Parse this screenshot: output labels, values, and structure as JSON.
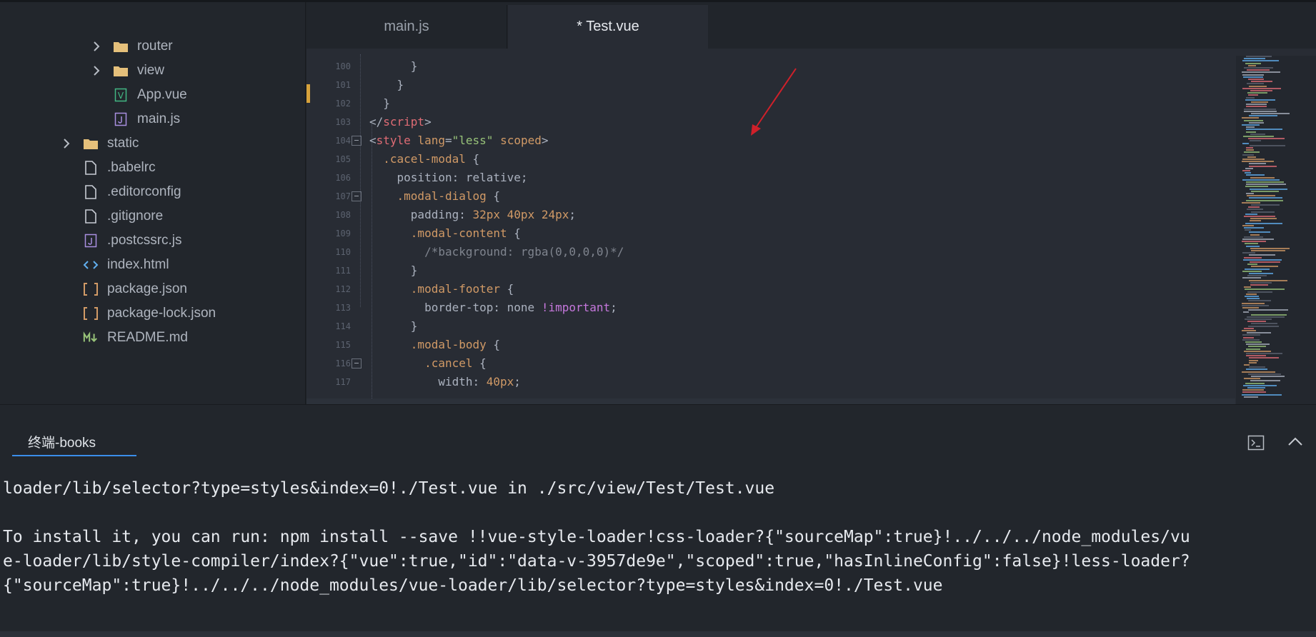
{
  "sidebar": {
    "items": [
      {
        "label": "router",
        "kind": "folder",
        "expandable": true,
        "depth": 2
      },
      {
        "label": "view",
        "kind": "folder",
        "expandable": true,
        "depth": 2
      },
      {
        "label": "App.vue",
        "kind": "vue",
        "expandable": false,
        "depth": 2
      },
      {
        "label": "main.js",
        "kind": "js",
        "expandable": false,
        "depth": 2
      },
      {
        "label": "static",
        "kind": "folder",
        "expandable": true,
        "depth": 1
      },
      {
        "label": ".babelrc",
        "kind": "file",
        "expandable": false,
        "depth": 1
      },
      {
        "label": ".editorconfig",
        "kind": "file",
        "expandable": false,
        "depth": 1
      },
      {
        "label": ".gitignore",
        "kind": "file",
        "expandable": false,
        "depth": 1
      },
      {
        "label": ".postcssrc.js",
        "kind": "js",
        "expandable": false,
        "depth": 1
      },
      {
        "label": "index.html",
        "kind": "html",
        "expandable": false,
        "depth": 1
      },
      {
        "label": "package.json",
        "kind": "json",
        "expandable": false,
        "depth": 1
      },
      {
        "label": "package-lock.json",
        "kind": "json",
        "expandable": false,
        "depth": 1
      },
      {
        "label": "README.md",
        "kind": "md",
        "expandable": false,
        "depth": 1
      }
    ]
  },
  "tabs": [
    {
      "label": "main.js",
      "active": false
    },
    {
      "label": "* Test.vue",
      "active": true
    }
  ],
  "code": {
    "lines": [
      {
        "n": "100",
        "fold": false,
        "segs": [
          [
            "t-brace",
            "      }"
          ]
        ]
      },
      {
        "n": "101",
        "fold": false,
        "segs": [
          [
            "t-brace",
            "    }"
          ]
        ]
      },
      {
        "n": "102",
        "fold": false,
        "segs": [
          [
            "t-brace",
            "  }"
          ]
        ]
      },
      {
        "n": "103",
        "fold": false,
        "segs": [
          [
            "t-plain",
            "</"
          ],
          [
            "t-tag",
            "script"
          ],
          [
            "t-plain",
            ">"
          ]
        ]
      },
      {
        "n": "104",
        "fold": true,
        "segs": [
          [
            "t-plain",
            "<"
          ],
          [
            "t-tag",
            "style"
          ],
          [
            "t-plain",
            " "
          ],
          [
            "t-attr",
            "lang"
          ],
          [
            "t-plain",
            "="
          ],
          [
            "t-str",
            "\"less\""
          ],
          [
            "t-plain",
            " "
          ],
          [
            "t-attr",
            "scoped"
          ],
          [
            "t-plain",
            ">"
          ]
        ]
      },
      {
        "n": "105",
        "fold": false,
        "segs": [
          [
            "t-plain",
            "  "
          ],
          [
            "t-attr",
            ".cacel-modal"
          ],
          [
            "t-plain",
            " {"
          ]
        ]
      },
      {
        "n": "106",
        "fold": false,
        "segs": [
          [
            "t-plain",
            "    position: relative;"
          ]
        ]
      },
      {
        "n": "107",
        "fold": true,
        "segs": [
          [
            "t-plain",
            "    "
          ],
          [
            "t-attr",
            ".modal-dialog"
          ],
          [
            "t-plain",
            " {"
          ]
        ]
      },
      {
        "n": "108",
        "fold": false,
        "segs": [
          [
            "t-plain",
            "      padding: "
          ],
          [
            "t-num",
            "32px 40px 24px"
          ],
          [
            "t-plain",
            ";"
          ]
        ]
      },
      {
        "n": "109",
        "fold": false,
        "segs": [
          [
            "t-plain",
            "      "
          ],
          [
            "t-attr",
            ".modal-content"
          ],
          [
            "t-plain",
            " {"
          ]
        ]
      },
      {
        "n": "110",
        "fold": false,
        "segs": [
          [
            "t-cmt",
            "        /*background: rgba(0,0,0,0)*/"
          ]
        ]
      },
      {
        "n": "111",
        "fold": false,
        "segs": [
          [
            "t-plain",
            "      }"
          ]
        ]
      },
      {
        "n": "112",
        "fold": false,
        "segs": [
          [
            "t-plain",
            "      "
          ],
          [
            "t-attr",
            ".modal-footer"
          ],
          [
            "t-plain",
            " {"
          ]
        ]
      },
      {
        "n": "113",
        "fold": false,
        "segs": [
          [
            "t-plain",
            "        border-top: none "
          ],
          [
            "t-imp",
            "!important"
          ],
          [
            "t-plain",
            ";"
          ]
        ]
      },
      {
        "n": "114",
        "fold": false,
        "segs": [
          [
            "t-plain",
            "      }"
          ]
        ]
      },
      {
        "n": "115",
        "fold": false,
        "segs": [
          [
            "t-plain",
            "      "
          ],
          [
            "t-attr",
            ".modal-body"
          ],
          [
            "t-plain",
            " {"
          ]
        ]
      },
      {
        "n": "116",
        "fold": true,
        "segs": [
          [
            "t-plain",
            "        "
          ],
          [
            "t-attr",
            ".cancel"
          ],
          [
            "t-plain",
            " {"
          ]
        ]
      },
      {
        "n": "117",
        "fold": false,
        "segs": [
          [
            "t-plain",
            "          width: "
          ],
          [
            "t-num",
            "40px"
          ],
          [
            "t-plain",
            ";"
          ]
        ]
      }
    ]
  },
  "terminal": {
    "tab_label": "终端-books",
    "lines": [
      "loader/lib/selector?type=styles&index=0!./Test.vue in ./src/view/Test/Test.vue",
      "",
      "To install it, you can run: npm install --save !!vue-style-loader!css-loader?{\"sourceMap\":true}!../../../node_modules/vu",
      "e-loader/lib/style-compiler/index?{\"vue\":true,\"id\":\"data-v-3957de9e\",\"scoped\":true,\"hasInlineConfig\":false}!less-loader?",
      "{\"sourceMap\":true}!../../../node_modules/vue-loader/lib/selector?type=styles&index=0!./Test.vue"
    ]
  },
  "colors": {
    "folder": "#e5c07b",
    "vue": "#42b883",
    "js": "#a98fe0",
    "html": "#61afef",
    "json": "#d19a66",
    "md": "#98c379",
    "accent": "#3b8eea",
    "arrow": "#d0202a"
  }
}
